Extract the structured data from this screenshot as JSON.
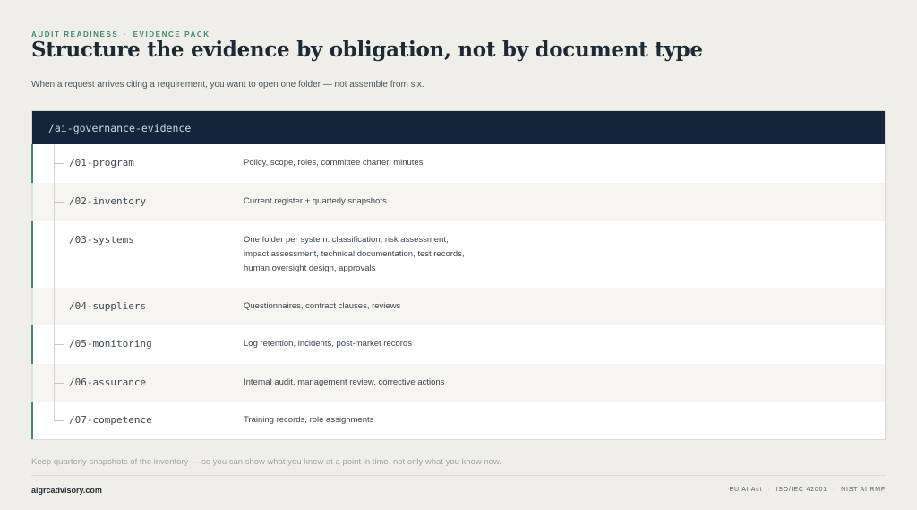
{
  "eyebrow": {
    "left": "AUDIT READINESS",
    "separator": "·",
    "right": "EVIDENCE PACK"
  },
  "title": "Structure the evidence by obligation, not by document type",
  "subtitle": "When a request arrives citing a requirement, you want to open one folder — not assemble from six.",
  "tree": {
    "root": "/ai-governance-evidence",
    "folders": [
      {
        "name": "/01-program",
        "description": "Policy, scope, roles, committee charter, minutes"
      },
      {
        "name": "/02-inventory",
        "description": "Current register + quarterly snapshots"
      },
      {
        "name": "/03-systems",
        "description_lines": [
          "One folder per system:  classification, risk assessment,",
          "impact assessment, technical documentation, test records,",
          "human oversight design, approvals"
        ]
      },
      {
        "name": "/04-suppliers",
        "description": "Questionnaires, contract clauses, reviews"
      },
      {
        "name": "/05-monitoring",
        "description": "Log retention, incidents, post-market records"
      },
      {
        "name": "/06-assurance",
        "description": "Internal audit, management review, corrective actions"
      },
      {
        "name": "/07-competence",
        "description": "Training records, role assignments"
      }
    ]
  },
  "footnote": "Keep quarterly snapshots of the inventory — so you can show what you knew at a point in time, not only what you know now.",
  "footer": {
    "site": "aigrcadvisory.com",
    "frameworks": [
      "EU AI Act",
      "ISO/IEC 42001",
      "NIST AI RMF"
    ],
    "separator": "·"
  },
  "colors": {
    "accent_green": "#3d8a6e",
    "header_navy": "#12253a",
    "background": "#efeee9",
    "row_alt": "#f6f5f1"
  }
}
